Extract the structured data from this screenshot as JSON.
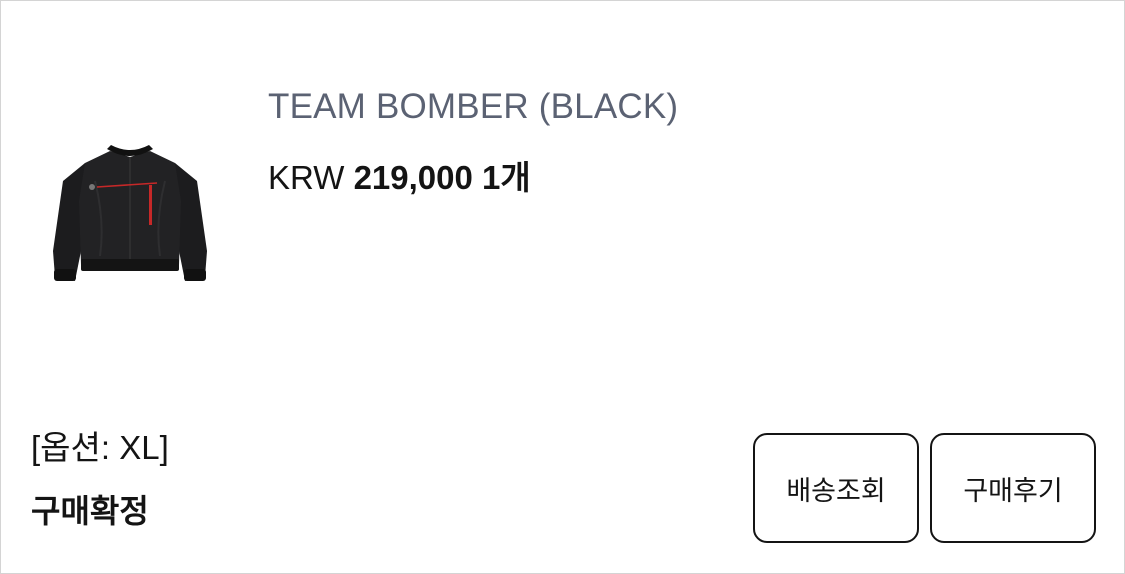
{
  "product": {
    "name": "TEAM BOMBER (BLACK)",
    "currency": "KRW",
    "price": "219,000",
    "quantity": "1개",
    "option": "[옵션: XL]",
    "image_alt": "black bomber jacket"
  },
  "order": {
    "status": "구매확정"
  },
  "actions": {
    "track_label": "배송조회",
    "review_label": "구매후기"
  },
  "colors": {
    "title": "#5b6273",
    "text": "#141414",
    "border": "#141414",
    "jacket": "#1c1c1e",
    "accent_stripe": "#c62828"
  }
}
